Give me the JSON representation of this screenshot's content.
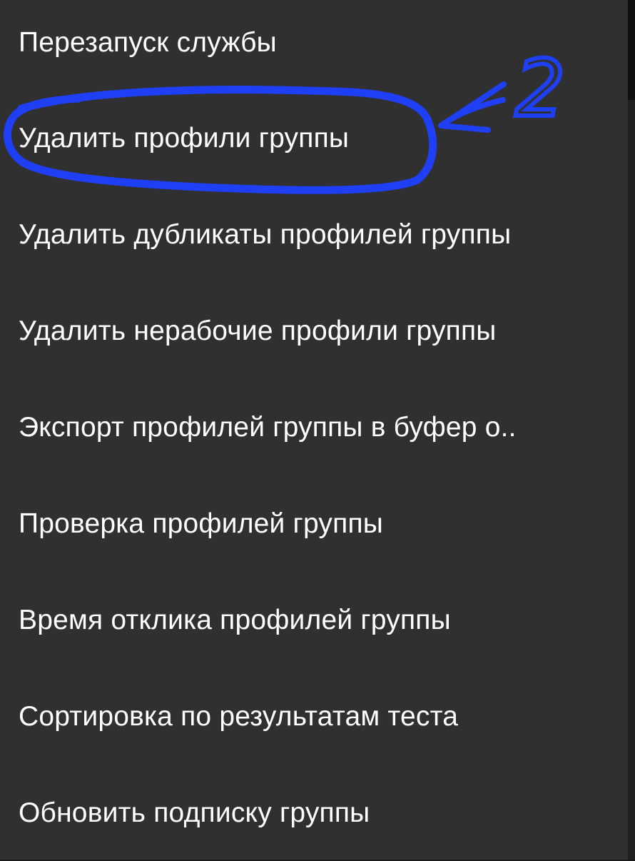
{
  "menu": {
    "items": [
      {
        "label": "Перезапуск службы"
      },
      {
        "label": "Удалить профили группы"
      },
      {
        "label": "Удалить дубликаты профилей группы"
      },
      {
        "label": "Удалить нерабочие профили группы"
      },
      {
        "label": "Экспорт профилей группы в буфер о.."
      },
      {
        "label": "Проверка профилей группы"
      },
      {
        "label": "Время отклика профилей группы"
      },
      {
        "label": "Сортировка по результатам теста"
      },
      {
        "label": "Обновить подписку группы"
      }
    ]
  },
  "annotation": {
    "number": "2",
    "color": "#1f3ff5"
  }
}
